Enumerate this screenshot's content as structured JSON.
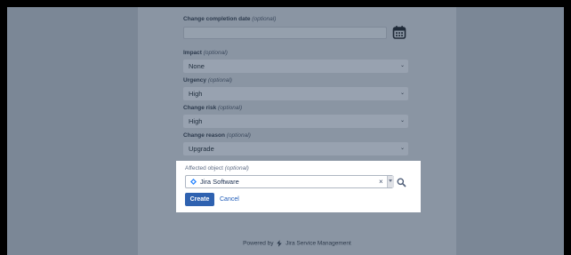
{
  "form": {
    "fields": [
      {
        "label": "Change completion date",
        "optional": "(optional)",
        "value": "",
        "icon": "calendar-icon"
      },
      {
        "label": "Impact",
        "optional": "(optional)",
        "value": "None"
      },
      {
        "label": "Urgency",
        "optional": "(optional)",
        "value": "High"
      },
      {
        "label": "Change risk",
        "optional": "(optional)",
        "value": "High"
      },
      {
        "label": "Change reason",
        "optional": "(optional)",
        "value": "Upgrade"
      }
    ],
    "affected_object": {
      "label": "Affected object",
      "optional": "(optional)",
      "value": "Jira Software",
      "clear_symbol": "×"
    },
    "create_label": "Create",
    "cancel_label": "Cancel"
  },
  "footer": {
    "prefix": "Powered by",
    "brand": "Jira Service Management"
  },
  "colors": {
    "primary_button": "#2f62b0",
    "link": "#1f5bb8",
    "overlay": "#7b8796"
  }
}
